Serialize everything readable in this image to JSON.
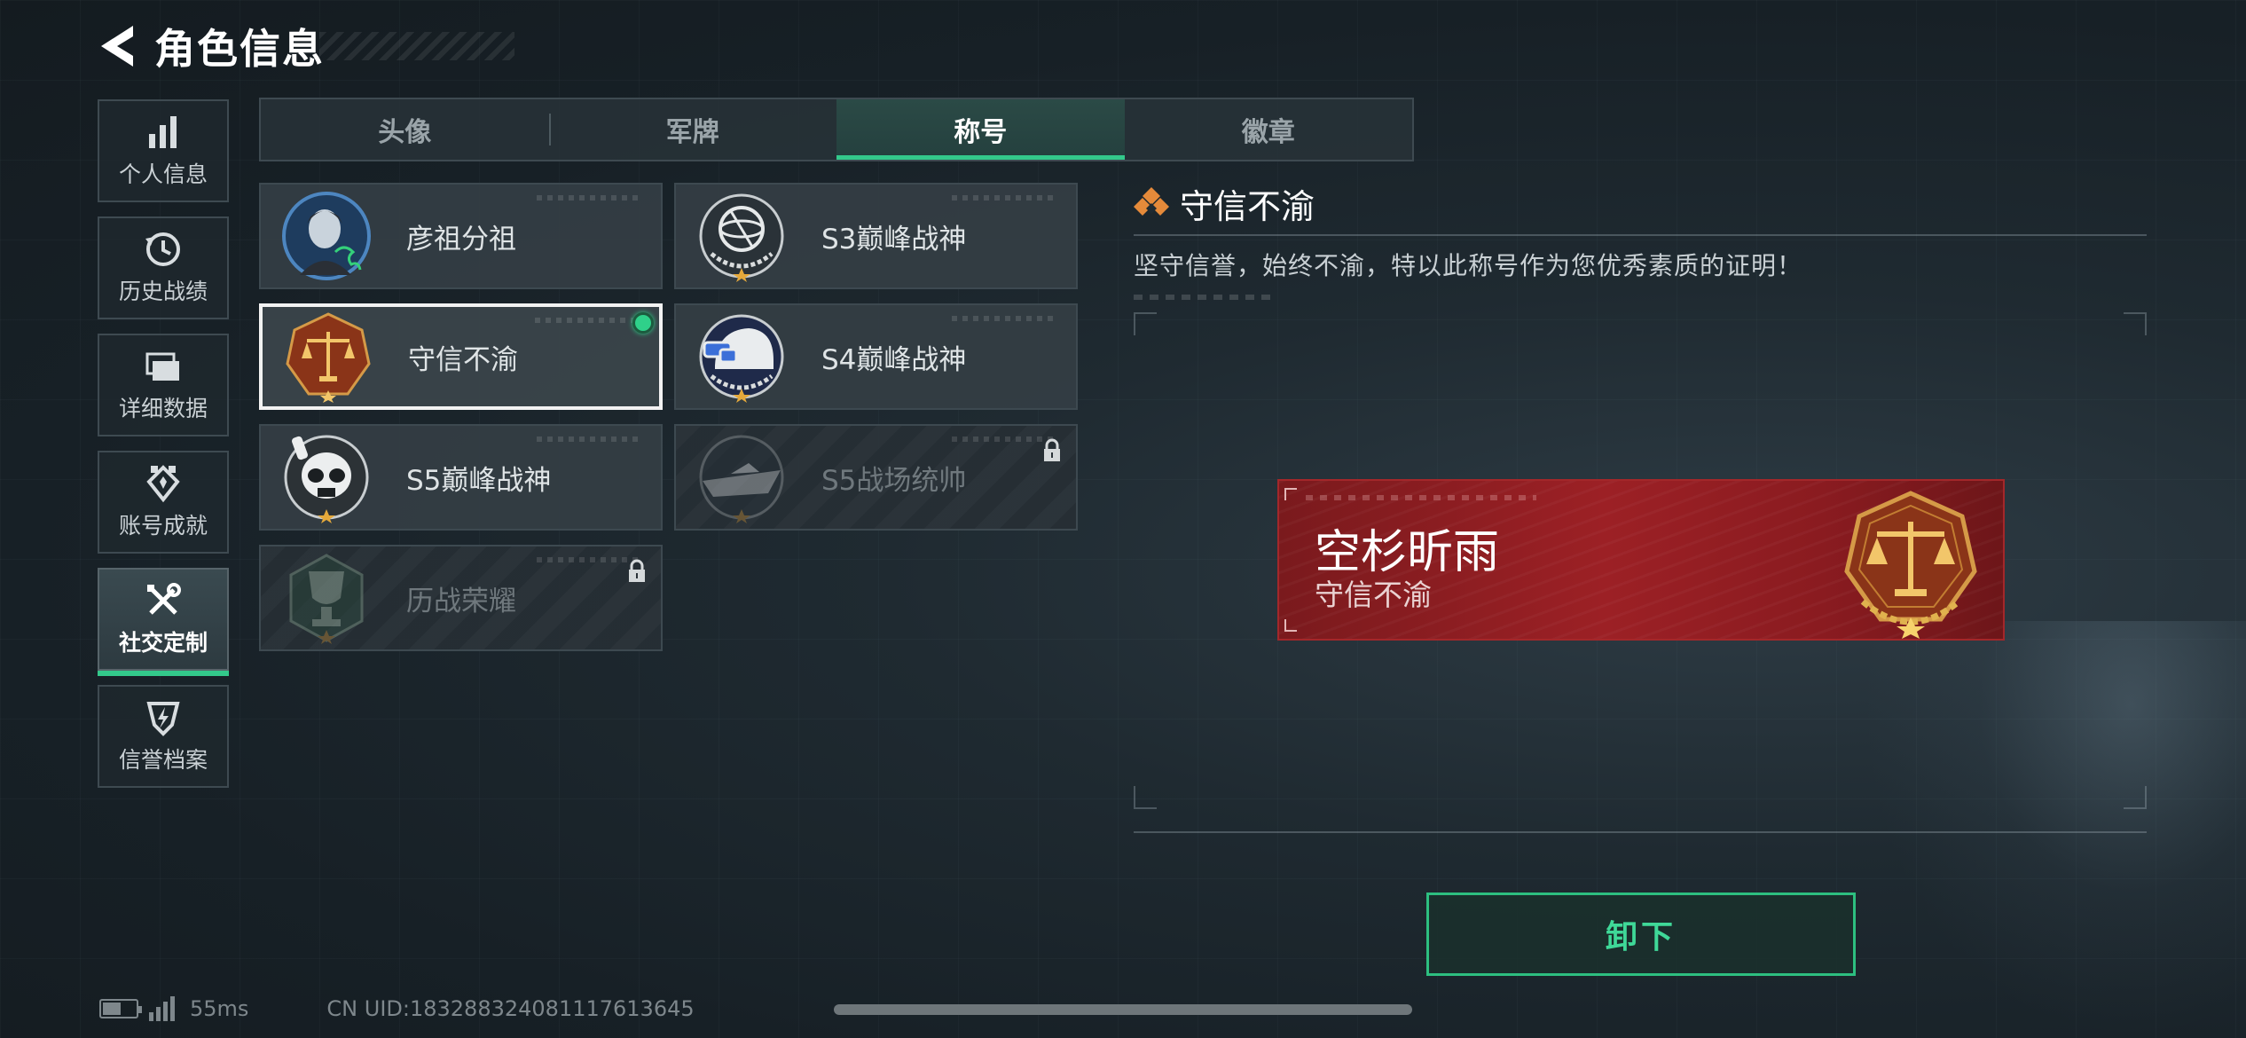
{
  "header": {
    "title": "角色信息"
  },
  "sidebar": {
    "items": [
      {
        "label": "个人信息",
        "icon": "bar-chart-icon"
      },
      {
        "label": "历史战绩",
        "icon": "history-icon"
      },
      {
        "label": "详细数据",
        "icon": "folder-icon"
      },
      {
        "label": "账号成就",
        "icon": "achievement-icon"
      },
      {
        "label": "社交定制",
        "icon": "tools-icon",
        "active": true
      },
      {
        "label": "信誉档案",
        "icon": "credit-icon"
      }
    ]
  },
  "tabs": [
    {
      "label": "头像"
    },
    {
      "label": "军牌"
    },
    {
      "label": "称号",
      "active": true
    },
    {
      "label": "徽章"
    }
  ],
  "titles": [
    {
      "label": "彦祖分祖",
      "emblem": "portrait-emblem"
    },
    {
      "label": "S3巅峰战神",
      "emblem": "globe-emblem"
    },
    {
      "label": "守信不渝",
      "emblem": "scales-emblem",
      "selected": true,
      "equipped": true
    },
    {
      "label": "S4巅峰战神",
      "emblem": "helmet-emblem"
    },
    {
      "label": "S5巅峰战神",
      "emblem": "skull-emblem"
    },
    {
      "label": "S5战场统帅",
      "emblem": "boat-emblem",
      "locked": true
    },
    {
      "label": "历战荣耀",
      "emblem": "trophy-emblem",
      "locked": true
    }
  ],
  "detail": {
    "title": "守信不渝",
    "description": "坚守信誉，始终不渝，特以此称号作为您优秀素质的证明！"
  },
  "banner": {
    "player_name": "空杉昕雨",
    "title": "守信不渝"
  },
  "actions": {
    "unequip_label": "卸下"
  },
  "status": {
    "ping": "55ms",
    "uid": "CN UID:1832883240811176136​45"
  },
  "colors": {
    "accent": "#33c98b",
    "banner_red": "#9c2025",
    "gold": "#d8a44a"
  }
}
